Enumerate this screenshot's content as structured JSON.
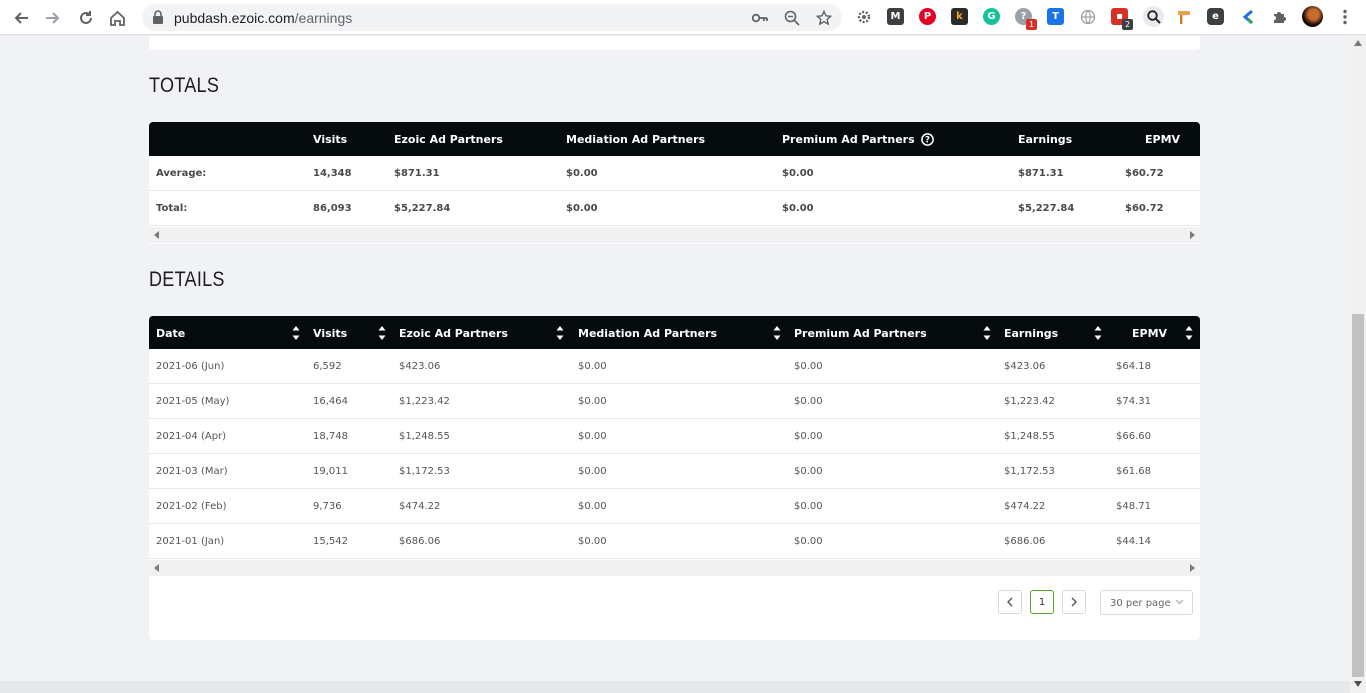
{
  "browser": {
    "url_host": "pubdash.ezoic.com",
    "url_path": "/earnings",
    "extensions": [
      {
        "name": "gear-ext-icon",
        "color": "#5f6368"
      },
      {
        "name": "m-ext-icon",
        "label": "M",
        "color": "#3c4043"
      },
      {
        "name": "pinterest-ext-icon",
        "color": "#e60023"
      },
      {
        "name": "k-ext-icon",
        "label": "k",
        "color": "#2b2b2b"
      },
      {
        "name": "grammarly-ext-icon",
        "label": "G",
        "color": "#15c39a"
      },
      {
        "name": "question-ext-icon",
        "label": "?",
        "color": "#9aa0a6",
        "badge": "1"
      },
      {
        "name": "t-ext-icon",
        "label": "T",
        "color": "#1a73e8"
      },
      {
        "name": "globe-ext-icon",
        "color": "#9aa0a6"
      },
      {
        "name": "calendar-ext-icon",
        "color": "#d93025",
        "badge": "2"
      },
      {
        "name": "search-ext-icon",
        "color": "#5f6368"
      },
      {
        "name": "paint-ext-icon",
        "color": "#e8a14d"
      },
      {
        "name": "evernote-ext-icon",
        "color": "#3c4043"
      },
      {
        "name": "k-blue-ext-icon",
        "color": "#1a73e8"
      },
      {
        "name": "puzzle-ext-icon",
        "color": "#5f6368"
      }
    ]
  },
  "totals": {
    "title": "TOTALS",
    "headers": [
      "",
      "Visits",
      "Ezoic Ad Partners",
      "Mediation Ad Partners",
      "Premium Ad Partners",
      "Earnings",
      "EPMV"
    ],
    "rows": [
      [
        "Average:",
        "14,348",
        "$871.31",
        "$0.00",
        "$0.00",
        "$871.31",
        "$60.72"
      ],
      [
        "Total:",
        "86,093",
        "$5,227.84",
        "$0.00",
        "$0.00",
        "$5,227.84",
        "$60.72"
      ]
    ]
  },
  "details": {
    "title": "DETAILS",
    "headers": [
      "Date",
      "Visits",
      "Ezoic Ad Partners",
      "Mediation Ad Partners",
      "Premium Ad Partners",
      "Earnings",
      "EPMV"
    ],
    "rows": [
      [
        "2021-06 (Jun)",
        "6,592",
        "$423.06",
        "$0.00",
        "$0.00",
        "$423.06",
        "$64.18"
      ],
      [
        "2021-05 (May)",
        "16,464",
        "$1,223.42",
        "$0.00",
        "$0.00",
        "$1,223.42",
        "$74.31"
      ],
      [
        "2021-04 (Apr)",
        "18,748",
        "$1,248.55",
        "$0.00",
        "$0.00",
        "$1,248.55",
        "$66.60"
      ],
      [
        "2021-03 (Mar)",
        "19,011",
        "$1,172.53",
        "$0.00",
        "$0.00",
        "$1,172.53",
        "$61.68"
      ],
      [
        "2021-02 (Feb)",
        "9,736",
        "$474.22",
        "$0.00",
        "$0.00",
        "$474.22",
        "$48.71"
      ],
      [
        "2021-01 (Jan)",
        "15,542",
        "$686.06",
        "$0.00",
        "$0.00",
        "$686.06",
        "$44.14"
      ]
    ]
  },
  "pagination": {
    "current_page": "1",
    "per_page": "30 per page"
  }
}
